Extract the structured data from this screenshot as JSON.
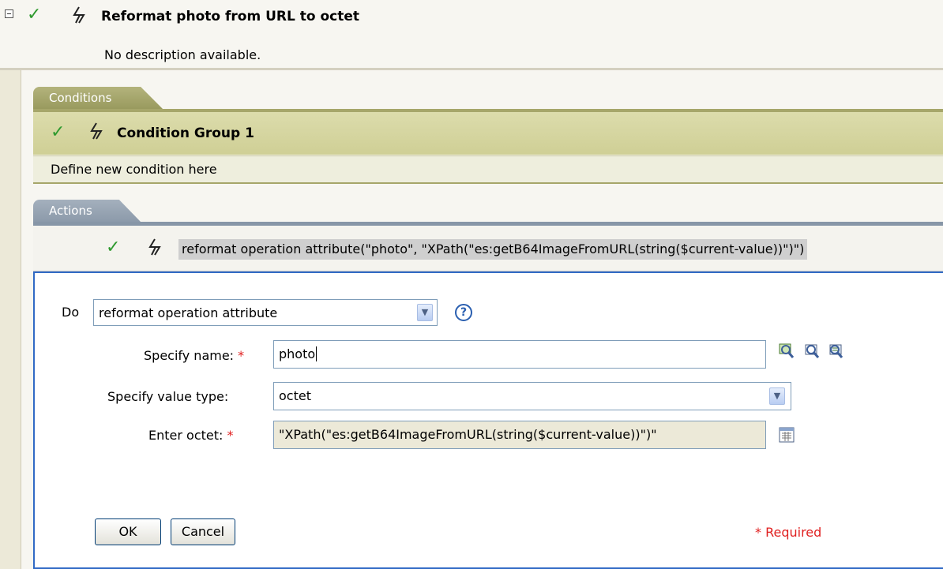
{
  "rule": {
    "title": "Reformat photo from URL to octet",
    "description": "No description available."
  },
  "conditions": {
    "tab_label": "Conditions",
    "group_title": "Condition Group 1",
    "new_condition_text": "Define new condition here"
  },
  "actions": {
    "tab_label": "Actions",
    "summary": "reformat operation attribute(\"photo\", \"XPath(\"es:getB64ImageFromURL(string($current-value))\")\")"
  },
  "editor": {
    "do_label": "Do",
    "do_value": "reformat operation attribute",
    "name_label": "Specify name:",
    "name_value": "photo",
    "value_type_label": "Specify value type:",
    "value_type_value": "octet",
    "octet_label": "Enter octet:",
    "octet_value": "\"XPath(\"es:getB64ImageFromURL(string($current-value))\")\"",
    "required_star": "*",
    "ok_label": "OK",
    "cancel_label": "Cancel",
    "required_note": "* Required"
  },
  "icons": {
    "check": "check-icon",
    "bolt": "lightning-icon",
    "help": "help-icon",
    "collapse": "collapse-icon"
  },
  "colors": {
    "conditions_tab": "#a6a66a",
    "actions_tab": "#8796a7",
    "editor_border": "#316ac5",
    "required": "#e02020",
    "check": "#2f9a2f"
  }
}
